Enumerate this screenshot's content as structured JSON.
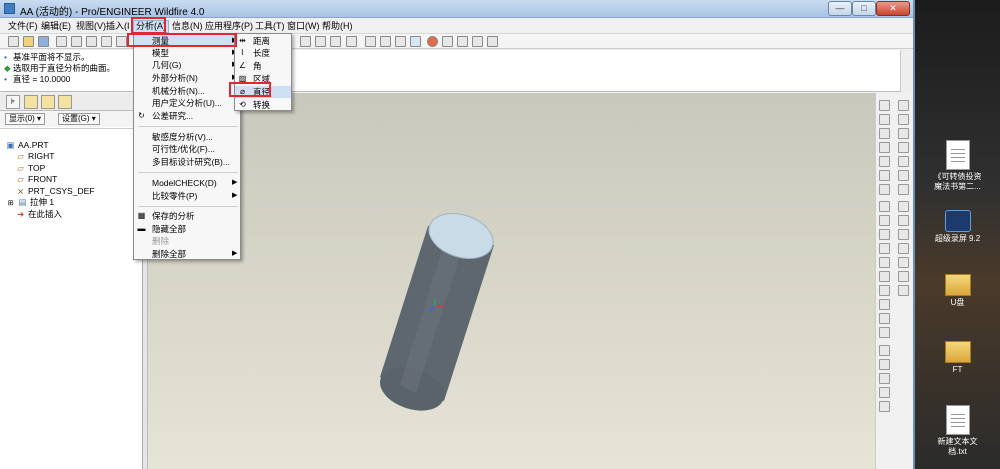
{
  "window": {
    "title": "AA (活动的) - Pro/ENGINEER Wildfire 4.0",
    "controls": {
      "minimize": "—",
      "maximize": "□",
      "close": "✕"
    }
  },
  "menubar": [
    "文件(F)",
    "编辑(E)",
    "视图(V)",
    "插入(I",
    "分析(A)",
    "信息(N)",
    "应用程序(P)",
    "工具(T)",
    "窗口(W)",
    "帮助(H)"
  ],
  "messages": [
    "基准平面将不显示。",
    "选取用于直径分析的曲面。",
    "直径 = 10.0000"
  ],
  "navigator": {
    "show_button": "显示(0)",
    "settings_button": "设置(G)",
    "tree": [
      {
        "label": "AA.PRT",
        "icon": "part-icon"
      },
      {
        "label": "RIGHT",
        "icon": "datum-plane-icon"
      },
      {
        "label": "TOP",
        "icon": "datum-plane-icon"
      },
      {
        "label": "FRONT",
        "icon": "datum-plane-icon"
      },
      {
        "label": "PRT_CSYS_DEF",
        "icon": "csys-icon"
      },
      {
        "label": "拉伸 1",
        "icon": "extrude-icon"
      },
      {
        "label": "在此插入",
        "icon": "insert-here-icon"
      }
    ]
  },
  "analysis_menu": {
    "items": [
      {
        "label": "测量",
        "has_submenu": true,
        "highlighted": true
      },
      {
        "label": "模型",
        "has_submenu": true
      },
      {
        "label": "几何(G)",
        "has_submenu": true
      },
      {
        "label": "外部分析(N)",
        "has_submenu": true
      },
      {
        "label": "机械分析(N)...",
        "has_submenu": false
      },
      {
        "label": "用户定义分析(U)...",
        "has_submenu": false
      },
      {
        "label": "公差研究...",
        "has_submenu": false
      },
      {
        "label": "敏感度分析(V)...",
        "has_submenu": false
      },
      {
        "label": "可行性/优化(F)...",
        "has_submenu": false
      },
      {
        "label": "多目标设计研究(B)...",
        "has_submenu": false
      },
      {
        "label": "ModelCHECK(D)",
        "has_submenu": true
      },
      {
        "label": "比较零件(P)",
        "has_submenu": true
      },
      {
        "label": "保存的分析",
        "has_submenu": false
      },
      {
        "label": "隐藏全部",
        "has_submenu": false
      },
      {
        "label": "删除",
        "has_submenu": false,
        "disabled": true
      },
      {
        "label": "删除全部",
        "has_submenu": true
      }
    ]
  },
  "measure_submenu": {
    "items": [
      {
        "label": "距离"
      },
      {
        "label": "长度"
      },
      {
        "label": "角"
      },
      {
        "label": "区域"
      },
      {
        "label": "直径",
        "highlighted": true
      },
      {
        "label": "转换"
      }
    ]
  },
  "desktop": {
    "icons": [
      {
        "label": "《可转债投资\n魔法书第二...",
        "icon": "document-icon"
      },
      {
        "label": "超级录屏 9.2",
        "icon": "video-app-icon"
      },
      {
        "label": "U盘",
        "icon": "folder-icon"
      },
      {
        "label": "FT",
        "icon": "folder-icon"
      },
      {
        "label": "新建文本文\n档.txt",
        "icon": "text-file-icon"
      }
    ]
  },
  "colors": {
    "highlight_box": "#e3262f",
    "menu_highlight": "#cfe0f4",
    "cylinder_body": "#5e6670",
    "cylinder_top": "#c9dbe6"
  }
}
